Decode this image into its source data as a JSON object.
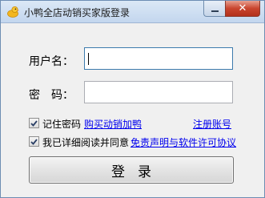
{
  "window": {
    "title": "小鸭全店动销买家版登录",
    "close_glyph": "✕"
  },
  "form": {
    "username_label": "用户名：",
    "username_value": "",
    "password_label": "密　码：",
    "password_value": ""
  },
  "options": {
    "remember_password": {
      "label": "记住密码",
      "checked": true
    },
    "buy_link": "购买动销加鸭",
    "register_link": "注册账号",
    "agree": {
      "label": "我已详细阅读并同意",
      "checked": true
    },
    "agreement_link": "免责声明与软件许可协议"
  },
  "login_button_label": "登录",
  "colors": {
    "accent_link": "#0000ee",
    "close_button": "#c9452e"
  }
}
